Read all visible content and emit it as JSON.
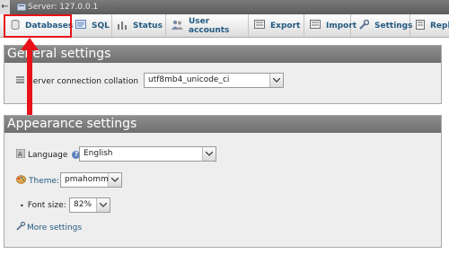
{
  "window": {
    "server_label": "Server: 127.0.0.1",
    "back_glyph": "←"
  },
  "tabs": [
    {
      "label": "Databases",
      "icon": "database-icon"
    },
    {
      "label": "SQL",
      "icon": "sql-icon"
    },
    {
      "label": "Status",
      "icon": "status-icon"
    },
    {
      "label": "User accounts",
      "icon": "users-icon"
    },
    {
      "label": "Export",
      "icon": "export-icon"
    },
    {
      "label": "Import",
      "icon": "import-icon"
    },
    {
      "label": "Settings",
      "icon": "wrench-icon"
    },
    {
      "label": "Repli",
      "icon": "replication-icon"
    }
  ],
  "general_settings": {
    "title": "General settings",
    "collation_label": "Server connection collation",
    "collation_value": "utf8mb4_unicode_ci"
  },
  "appearance_settings": {
    "title": "Appearance settings",
    "language_label": "Language",
    "language_value": "English",
    "theme_label": "Theme:",
    "theme_value": "pmahomme",
    "font_size_label": "Font size:",
    "font_size_value": "82%",
    "more_settings_label": "More settings"
  },
  "colors": {
    "highlight": "#e8121b",
    "link": "#235a81",
    "panel_header": "#7a7a7a"
  },
  "help_glyph": "?"
}
